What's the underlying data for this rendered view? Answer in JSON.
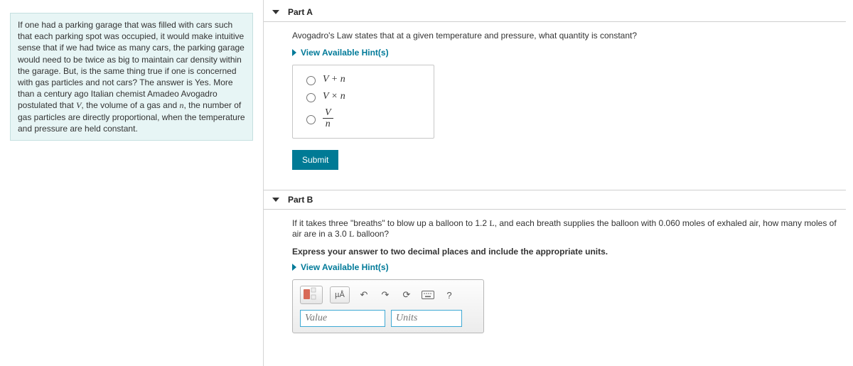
{
  "sidebar": {
    "info_html": "If one had a parking garage that was filled with cars such that each parking spot was occupied, it would make intuitive sense that if we had twice as many cars, the parking garage would need to be twice as big to maintain car density within the garage. But, is the same thing true if one is concerned with gas particles and not cars? The answer is Yes. More than a century ago Italian chemist Amadeo Avogadro postulated that <span class=\"math-it\">V</span>, the volume of a gas and <span class=\"math-it\">n</span>, the number of gas particles are directly proportional, when the temperature and pressure are held constant."
  },
  "partA": {
    "label": "Part A",
    "question": "Avogadro's Law states that at a given temperature and pressure, what quantity is constant?",
    "hint": "View Available Hint(s)",
    "options": {
      "opt1": "V + n",
      "opt2": "V × n",
      "opt3_num": "V",
      "opt3_den": "n"
    },
    "submit": "Submit"
  },
  "partB": {
    "label": "Part B",
    "question_html": "If it takes three \"breaths\" to blow up a balloon to 1.2 <span class=\"serif-L\">L</span>, and each breath supplies the balloon with 0.060 moles of exhaled air, how many moles of air are in a 3.0 <span class=\"serif-L\">L</span> balloon?",
    "instruction": "Express your answer to two decimal places and include the appropriate units.",
    "hint": "View Available Hint(s)",
    "toolbar": {
      "units_btn": "µÅ",
      "help": "?"
    },
    "inputs": {
      "value_ph": "Value",
      "units_ph": "Units"
    }
  }
}
